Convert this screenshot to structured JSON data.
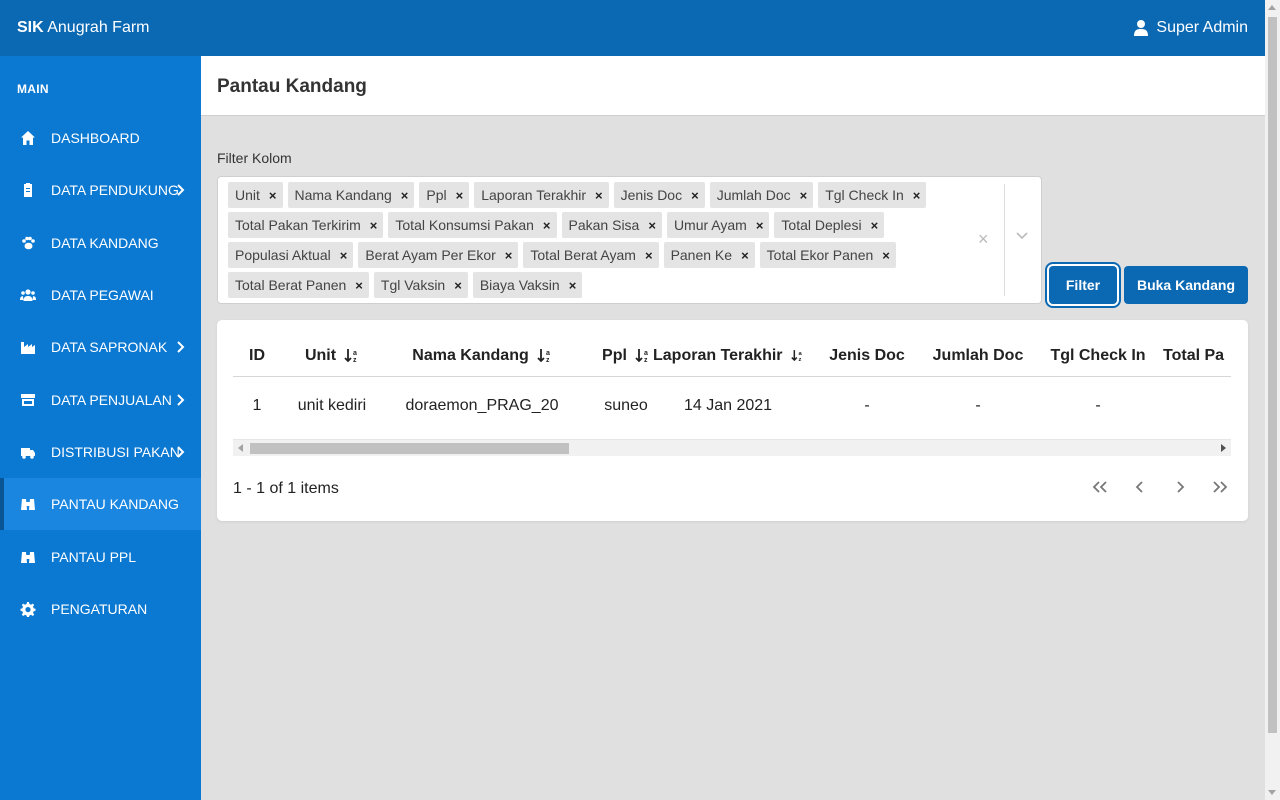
{
  "app": {
    "brand_bold": "SIK",
    "brand_rest": " Anugrah Farm",
    "user_name": "Super Admin"
  },
  "sidebar": {
    "section": "MAIN",
    "items": [
      {
        "label": "DASHBOARD",
        "icon": "home-icon",
        "has_submenu": false,
        "active": false
      },
      {
        "label": "DATA PENDUKUNG",
        "icon": "clipboard-icon",
        "has_submenu": true,
        "active": false
      },
      {
        "label": "DATA KANDANG",
        "icon": "paw-icon",
        "has_submenu": false,
        "active": false
      },
      {
        "label": "DATA PEGAWAI",
        "icon": "users-icon",
        "has_submenu": false,
        "active": false
      },
      {
        "label": "DATA SAPRONAK",
        "icon": "industry-icon",
        "has_submenu": true,
        "active": false
      },
      {
        "label": "DATA PENJUALAN",
        "icon": "store-icon",
        "has_submenu": true,
        "active": false
      },
      {
        "label": "DISTRIBUSI PAKAN",
        "icon": "truck-icon",
        "has_submenu": true,
        "active": false
      },
      {
        "label": "PANTAU KANDANG",
        "icon": "binoculars-icon",
        "has_submenu": false,
        "active": true
      },
      {
        "label": "PANTAU PPL",
        "icon": "binoculars-icon",
        "has_submenu": false,
        "active": false
      },
      {
        "label": "PENGATURAN",
        "icon": "gear-icon",
        "has_submenu": false,
        "active": false
      }
    ]
  },
  "page": {
    "title": "Pantau Kandang"
  },
  "filter": {
    "label": "Filter Kolom",
    "clear_symbol": "×",
    "remove_symbol": "×",
    "tags": [
      "Unit",
      "Nama Kandang",
      "Ppl",
      "Laporan Terakhir",
      "Jenis Doc",
      "Jumlah Doc",
      "Tgl Check In",
      "Total Pakan Terkirim",
      "Total Konsumsi Pakan",
      "Pakan Sisa",
      "Umur Ayam",
      "Total Deplesi",
      "Populasi Aktual",
      "Berat Ayam Per Ekor",
      "Total Berat Ayam",
      "Panen Ke",
      "Total Ekor Panen",
      "Total Berat Panen",
      "Tgl Vaksin",
      "Biaya Vaksin"
    ]
  },
  "buttons": {
    "filter": "Filter",
    "buka_kandang": "Buka Kandang"
  },
  "table": {
    "columns": [
      {
        "label": "ID",
        "sortable": false
      },
      {
        "label": "Unit",
        "sortable": true
      },
      {
        "label": "Nama Kandang",
        "sortable": true
      },
      {
        "label": "Ppl",
        "sortable": true
      },
      {
        "label": "Laporan Terakhir",
        "sortable": true
      },
      {
        "label": "Jenis Doc",
        "sortable": false
      },
      {
        "label": "Jumlah Doc",
        "sortable": false
      },
      {
        "label": "Tgl Check In",
        "sortable": false
      },
      {
        "label": "Total Pa",
        "sortable": false
      }
    ],
    "rows": [
      [
        "1",
        "unit kediri",
        "doraemon_PRAG_20",
        "suneo",
        "14 Jan 2021",
        "-",
        "-",
        "-",
        ""
      ]
    ]
  },
  "pagination": {
    "info": "1 - 1 of 1 items"
  },
  "colors": {
    "topbar": "#0b68b3",
    "sidebar": "#0b78d1",
    "sidebar_active": "#1a86df",
    "button": "#0b68b3"
  }
}
